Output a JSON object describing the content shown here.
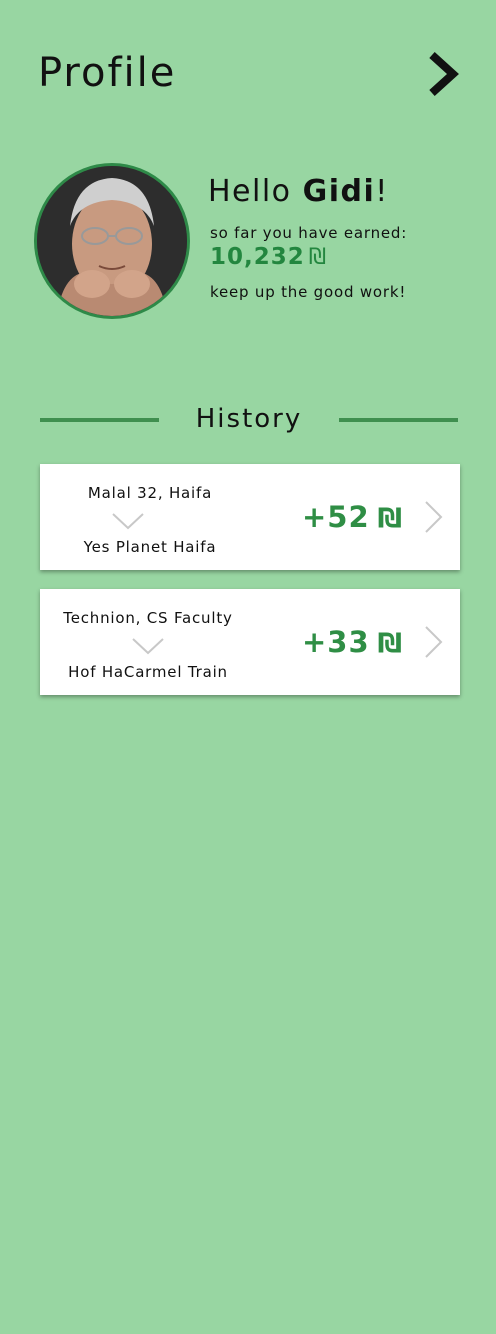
{
  "header": {
    "title": "Profile",
    "next_icon": "chevron-right-icon"
  },
  "profile": {
    "avatar": "user-portrait",
    "greeting_prefix": "Hello ",
    "name": "Gidi",
    "greeting_suffix": "!",
    "earned_label": "so far you have earned:",
    "earned_amount": "10,232",
    "currency_symbol": "₪",
    "encouragement": "keep up the good work!"
  },
  "history": {
    "title": "History",
    "items": [
      {
        "from": "Malal 32, Haifa",
        "to": "Yes Planet Haifa",
        "amount": "+52",
        "currency": "₪"
      },
      {
        "from": "Technion, CS Faculty",
        "to": "Hof HaCarmel Train",
        "amount": "+33",
        "currency": "₪"
      }
    ]
  },
  "colors": {
    "background": "#98d6a2",
    "accent_green": "#2f8e45",
    "divider": "#3f8f4f",
    "card": "#ffffff"
  }
}
